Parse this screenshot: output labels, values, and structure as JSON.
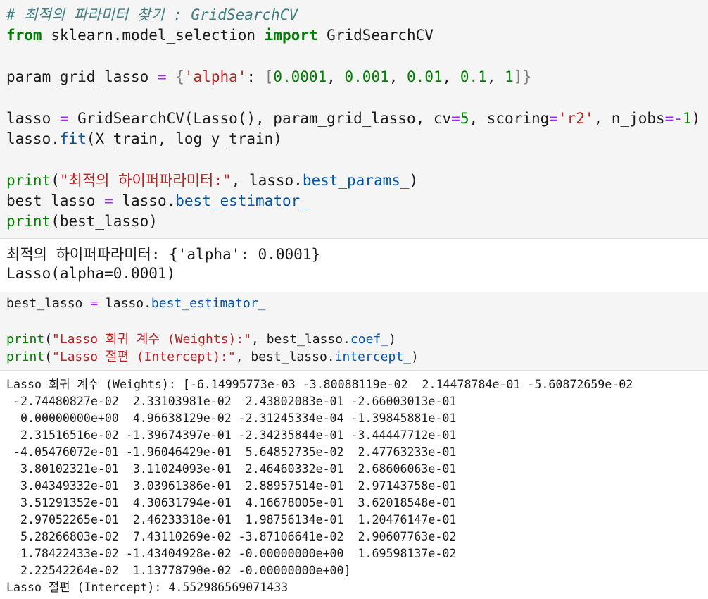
{
  "cell1": {
    "comment": "# 최적의 파라미터 찾기 : GridSearchCV",
    "import_from": "from",
    "import_module": " sklearn.model_selection ",
    "import_kw": "import",
    "import_name": " GridSearchCV",
    "pg_name": "param_grid_lasso ",
    "pg_eq": "=",
    "pg_open": " {",
    "pg_key": "'alpha'",
    "pg_colon": ": ",
    "pg_lopen": "[",
    "pg_v1": "0.0001",
    "pg_c1": ", ",
    "pg_v2": "0.001",
    "pg_c2": ", ",
    "pg_v3": "0.01",
    "pg_c3": ", ",
    "pg_v4": "0.1",
    "pg_c4": ", ",
    "pg_v5": "1",
    "pg_close": "]}",
    "gs_a": "lasso ",
    "gs_eq": "=",
    "gs_b": " GridSearchCV(Lasso(), param_grid_lasso, cv",
    "gs_eq2": "=",
    "gs_cv": "5",
    "gs_c": ", scoring",
    "gs_eq3": "=",
    "gs_r2": "'r2'",
    "gs_d": ", n_jobs",
    "gs_eq4": "=-",
    "gs_nj": "1",
    "gs_e": ")",
    "fit_a": "lasso.",
    "fit_b": "fit",
    "fit_c": "(X_train, log_y_train)",
    "p1_fn": "print",
    "p1_a": "(",
    "p1_str": "\"최적의 하이퍼파라미터:\"",
    "p1_b": ", lasso.",
    "p1_attr": "best_params_",
    "p1_c": ")",
    "be_a": "best_lasso ",
    "be_eq": "=",
    "be_b": " lasso.",
    "be_attr": "best_estimator_",
    "p2_fn": "print",
    "p2_a": "(best_lasso)"
  },
  "out1": {
    "line1": "최적의 하이퍼파라미터: {'alpha': 0.0001}",
    "line2": "Lasso(alpha=0.0001)"
  },
  "cell2": {
    "be_a": "best_lasso ",
    "be_eq": "=",
    "be_b": " lasso.",
    "be_attr": "best_estimator_",
    "p1_fn": "print",
    "p1_a": "(",
    "p1_str": "\"Lasso 회귀 계수 (Weights):\"",
    "p1_b": ", best_lasso.",
    "p1_attr": "coef_",
    "p1_c": ")",
    "p2_fn": "print",
    "p2_a": "(",
    "p2_str": "\"Lasso 절편 (Intercept):\"",
    "p2_b": ", best_lasso.",
    "p2_attr": "intercept_",
    "p2_c": ")"
  },
  "out2": {
    "lines": [
      "Lasso 회귀 계수 (Weights): [-6.14995773e-03 -3.80088119e-02  2.14478784e-01 -5.60872659e-02",
      " -2.74480827e-02  2.33103981e-02  2.43802083e-01 -2.66003013e-01",
      "  0.00000000e+00  4.96638129e-02 -2.31245334e-04 -1.39845881e-01",
      "  2.31516516e-02 -1.39674397e-01 -2.34235844e-01 -3.44447712e-01",
      " -4.05476072e-01 -1.96046429e-01  5.64852735e-02  2.47763233e-01",
      "  3.80102321e-01  3.11024093e-01  2.46460332e-01  2.68606063e-01",
      "  3.04349332e-01  3.03961386e-01  2.88957514e-01  2.97143758e-01",
      "  3.51291352e-01  4.30631794e-01  4.16678005e-01  3.62018548e-01",
      "  2.97052265e-01  2.46233318e-01  1.98756134e-01  1.20476147e-01",
      "  5.28266803e-02  7.43110269e-02 -3.87106641e-02  2.90607763e-02",
      "  1.78422433e-02 -1.43404928e-02 -0.00000000e+00  1.69598137e-02",
      "  2.22542264e-02  1.13778790e-02 -0.00000000e+00]",
      "Lasso 절편 (Intercept): 4.552986569071433"
    ]
  }
}
